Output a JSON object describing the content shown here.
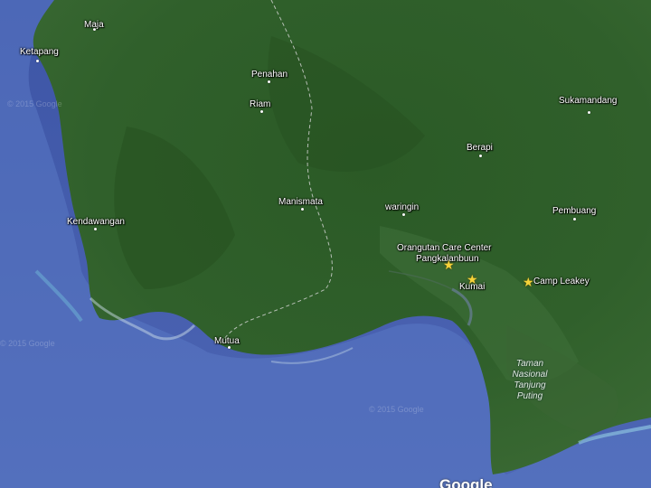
{
  "map": {
    "places": {
      "maja": "Maja",
      "ketapang": "Ketapang",
      "penahan": "Penahan",
      "riam": "Riam",
      "sukamandang": "Sukamandang",
      "berapi": "Berapi",
      "manismata": "Manismata",
      "waringin": "waringin",
      "kendawangan": "Kendawangan",
      "pembuang": "Pembuang",
      "mutua": "Mutua",
      "kumai": "Kumai"
    },
    "markers": {
      "orangutan_line1": "Orangutan Care Center",
      "orangutan_line2": "Pangkalanbuun",
      "camp_leakey": "Camp Leakey"
    },
    "park": [
      "Taman",
      "Nasional",
      "Tanjung",
      "Puting"
    ],
    "watermark": "© 2015 Google",
    "logo": "Google",
    "colors": {
      "land": "#2f5a2a",
      "sea": "#4a60a8",
      "marker": "#f5d23a"
    }
  }
}
